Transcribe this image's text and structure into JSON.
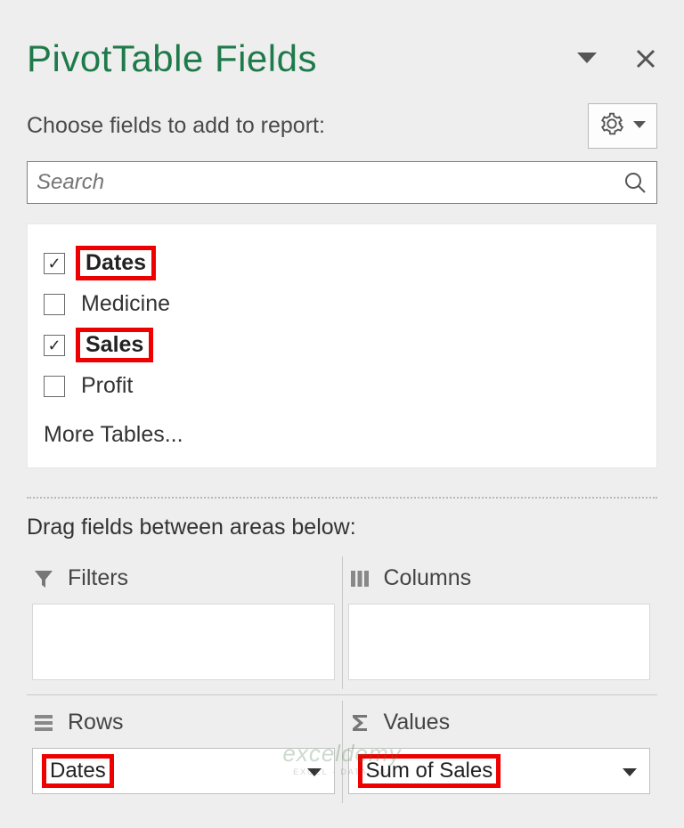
{
  "header": {
    "title": "PivotTable Fields"
  },
  "subhead": "Choose fields to add to report:",
  "search": {
    "placeholder": "Search"
  },
  "fields": [
    {
      "label": "Dates",
      "checked": true,
      "highlighted": true
    },
    {
      "label": "Medicine",
      "checked": false,
      "highlighted": false
    },
    {
      "label": "Sales",
      "checked": true,
      "highlighted": true
    },
    {
      "label": "Profit",
      "checked": false,
      "highlighted": false
    }
  ],
  "more_tables": "More Tables...",
  "drag_text": "Drag fields between areas below:",
  "areas": {
    "filters": {
      "title": "Filters"
    },
    "columns": {
      "title": "Columns"
    },
    "rows": {
      "title": "Rows",
      "item": "Dates"
    },
    "values": {
      "title": "Values",
      "item": "Sum of Sales"
    }
  },
  "watermark": {
    "line1": "exceldemy",
    "line2": "EXCEL · DATA · BI"
  }
}
